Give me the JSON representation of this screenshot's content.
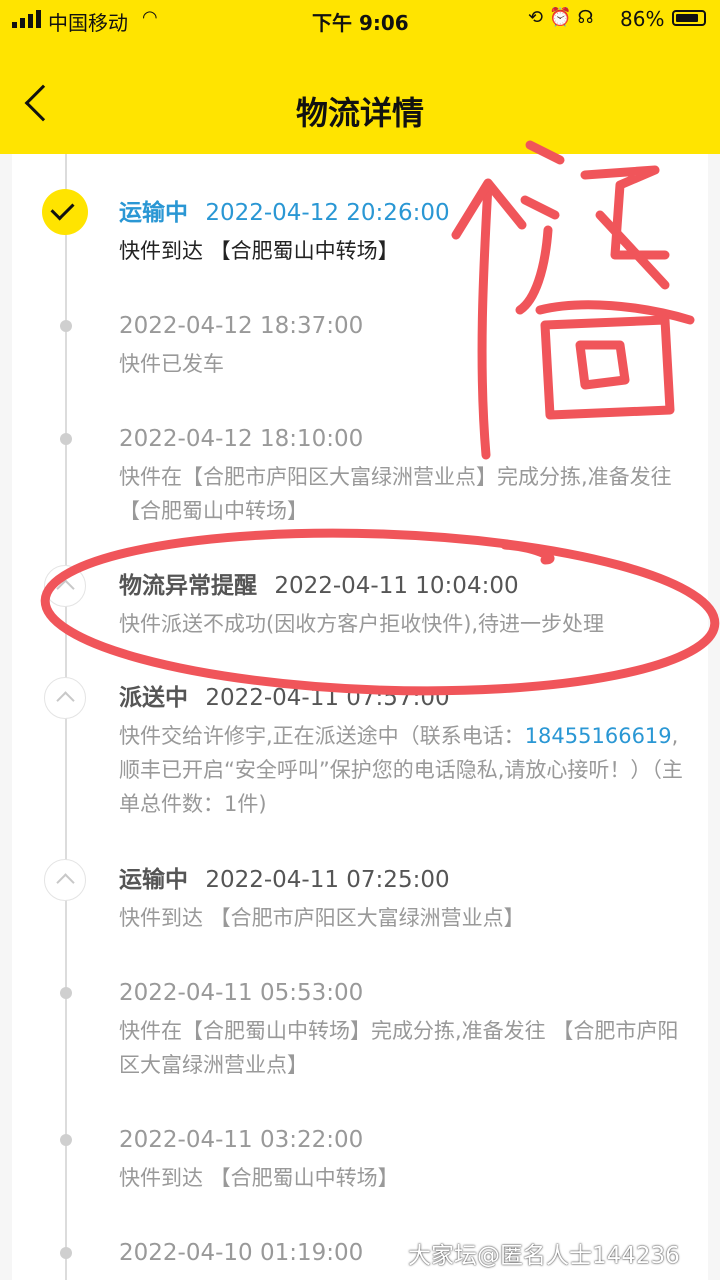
{
  "status_bar": {
    "carrier": "中国移动",
    "time": "下午 9:06",
    "battery": "86%",
    "battery_level": 0.86
  },
  "nav": {
    "title": "物流详情"
  },
  "timeline": [
    {
      "status": "运输中",
      "time": "2022-04-12 20:26:00",
      "desc": "快件到达 【合肥蜀山中转场】"
    },
    {
      "time": "2022-04-12 18:37:00",
      "desc": "快件已发车"
    },
    {
      "time": "2022-04-12 18:10:00",
      "desc": "快件在【合肥市庐阳区大富绿洲营业点】完成分拣,准备发往 【合肥蜀山中转场】"
    },
    {
      "status": "物流异常提醒",
      "time": "2022-04-11 10:04:00",
      "desc": "快件派送不成功(因收方客户拒收快件),待进一步处理"
    },
    {
      "status": "派送中",
      "time": "2022-04-11 07:57:00",
      "desc_before": "快件交给许修宇,正在派送途中（联系电话：",
      "phone": "18455166619",
      "desc_after": ",顺丰已开启“安全呼叫”保护您的电话隐私,请放心接听！）（主单总件数：1件)"
    },
    {
      "status": "运输中",
      "time": "2022-04-11 07:25:00",
      "desc": "快件到达 【合肥市庐阳区大富绿洲营业点】"
    },
    {
      "time": "2022-04-11 05:53:00",
      "desc": "快件在【合肥蜀山中转场】完成分拣,准备发往 【合肥市庐阳区大富绿洲营业点】"
    },
    {
      "time": "2022-04-11 03:22:00",
      "desc": "快件到达 【合肥蜀山中转场】"
    },
    {
      "time": "2022-04-10 01:19:00"
    }
  ],
  "annotation": {
    "text": "返回",
    "color": "#f0555a"
  },
  "watermark": "大家坛@匿名人士144236",
  "colors": {
    "accent": "#ffe400",
    "link": "#2a97d4"
  }
}
